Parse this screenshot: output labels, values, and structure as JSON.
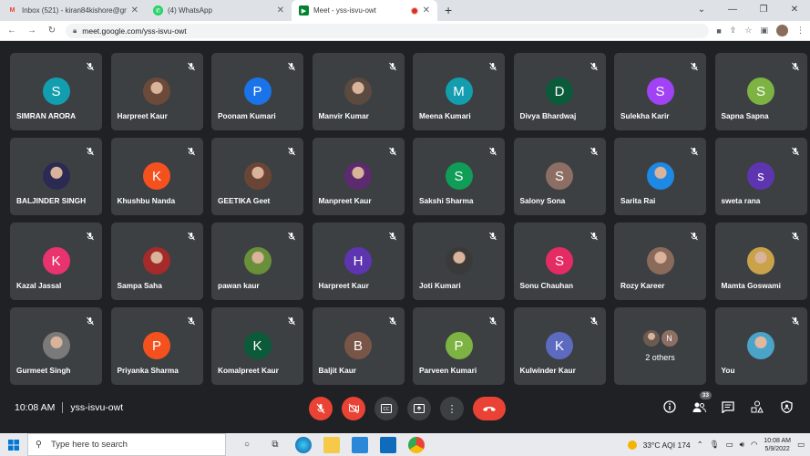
{
  "browser": {
    "tabs": [
      {
        "favicon": "gmail-icon",
        "title": "Inbox (521) - kiran84kishore@gm",
        "favicon_color": "#ea4335",
        "favicon_char": "M",
        "active": false
      },
      {
        "favicon": "whatsapp-icon",
        "title": "(4) WhatsApp",
        "favicon_color": "#25d366",
        "favicon_char": "✆",
        "active": false
      },
      {
        "favicon": "meet-icon",
        "title": "Meet - yss-isvu-owt",
        "favicon_color": "#00832d",
        "favicon_char": "▶",
        "active": true
      }
    ],
    "new_tab_label": "+",
    "url": "meet.google.com/yss-isvu-owt"
  },
  "participants": [
    {
      "name": "SIMRAN ARORA",
      "initial": "S",
      "color": "#129eaf",
      "photo": false
    },
    {
      "name": "Harpreet Kaur",
      "initial": "",
      "color": "#6b4a3a",
      "photo": true
    },
    {
      "name": "Poonam Kumari",
      "initial": "P",
      "color": "#1a73e8",
      "photo": false
    },
    {
      "name": "Manvir Kumar",
      "initial": "",
      "color": "#5a4a40",
      "photo": true
    },
    {
      "name": "Meena Kumari",
      "initial": "M",
      "color": "#129eaf",
      "photo": false
    },
    {
      "name": "Divya Bhardwaj",
      "initial": "D",
      "color": "#0b5a3a",
      "photo": false
    },
    {
      "name": "Sulekha Karir",
      "initial": "S",
      "color": "#a142f4",
      "photo": false
    },
    {
      "name": "Sapna Sapna",
      "initial": "S",
      "color": "#7cb342",
      "photo": false
    },
    {
      "name": "BALJINDER SINGH",
      "initial": "",
      "color": "#2b2a52",
      "photo": true
    },
    {
      "name": "Khushbu Nanda",
      "initial": "K",
      "color": "#f4511e",
      "photo": false
    },
    {
      "name": "GEETIKA Geet",
      "initial": "",
      "color": "#6a4535",
      "photo": true
    },
    {
      "name": "Manpreet Kaur",
      "initial": "",
      "color": "#5c2a6e",
      "photo": true
    },
    {
      "name": "Sakshi Sharma",
      "initial": "S",
      "color": "#0f9d58",
      "photo": false
    },
    {
      "name": "Salony Sona",
      "initial": "S",
      "color": "#8d6e63",
      "photo": false
    },
    {
      "name": "Sarita Rai",
      "initial": "",
      "color": "#1e88e5",
      "photo": true
    },
    {
      "name": "sweta rana",
      "initial": "s",
      "color": "#5e35b1",
      "photo": false
    },
    {
      "name": "Kazal Jassal",
      "initial": "K",
      "color": "#e8336f",
      "photo": false
    },
    {
      "name": "Sampa Saha",
      "initial": "",
      "color": "#a52a2a",
      "photo": true
    },
    {
      "name": "pawan kaur",
      "initial": "",
      "color": "#6a8f3a",
      "photo": true
    },
    {
      "name": "Harpreet Kaur",
      "initial": "H",
      "color": "#5e35b1",
      "photo": false
    },
    {
      "name": "Joti Kumari",
      "initial": "",
      "color": "#3a3a3a",
      "photo": true
    },
    {
      "name": "Sonu Chauhan",
      "initial": "S",
      "color": "#e52b63",
      "photo": false
    },
    {
      "name": "Rozy Kareer",
      "initial": "",
      "color": "#8a6a5a",
      "photo": true
    },
    {
      "name": "Mamta Goswami",
      "initial": "",
      "color": "#c9a24a",
      "photo": true
    },
    {
      "name": "Gurmeet Singh",
      "initial": "",
      "color": "#7a7a7a",
      "photo": true
    },
    {
      "name": "Priyanka Sharma",
      "initial": "P",
      "color": "#f4511e",
      "photo": false
    },
    {
      "name": "Komalpreet Kaur",
      "initial": "K",
      "color": "#0b5a3a",
      "photo": false
    },
    {
      "name": "Baljit Kaur",
      "initial": "B",
      "color": "#795548",
      "photo": false
    },
    {
      "name": "Parveen Kumari",
      "initial": "P",
      "color": "#7cb342",
      "photo": false
    },
    {
      "name": "Kulwinder Kaur",
      "initial": "K",
      "color": "#5c6bc0",
      "photo": false
    }
  ],
  "others_tile": {
    "label": "2 others",
    "initial": "N"
  },
  "self_tile": {
    "name": "You"
  },
  "meeting": {
    "time": "10:08 AM",
    "code": "yss-isvu-owt",
    "participant_count": "33"
  },
  "taskbar": {
    "search_placeholder": "Type here to search",
    "weather": "33°C  AQI 174",
    "time": "10:08 AM",
    "date": "5/9/2022"
  }
}
